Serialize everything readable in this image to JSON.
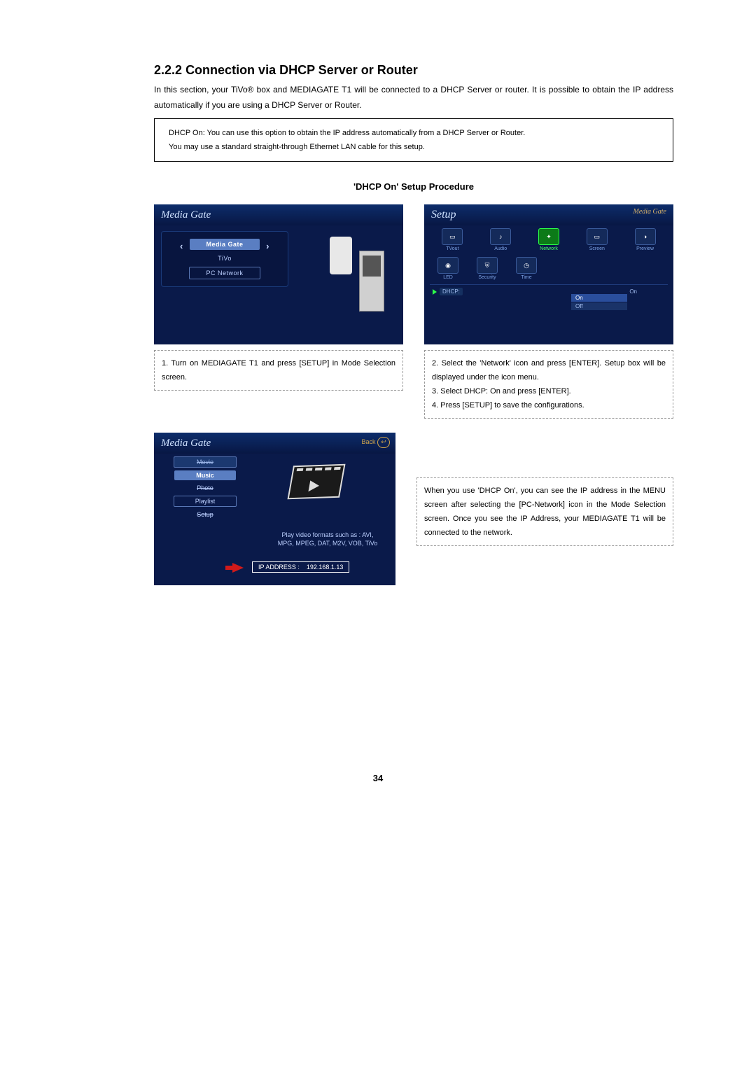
{
  "section": {
    "number": "2.2.2",
    "title": "Connection via DHCP Server or Router",
    "intro": "In this section, your TiVo® box and MEDIAGATE T1 will be connected to a DHCP Server or router. It is possible to obtain the IP address automatically if you are using a DHCP Server or Router."
  },
  "note_box": {
    "line1": "DHCP On: You can use this option to obtain the IP address automatically from a DHCP Server or Router.",
    "line2": "You may use a standard straight-through Ethernet LAN cable for this setup."
  },
  "procedure_title": "'DHCP On' Setup Procedure",
  "figure1": {
    "brand": "Media Gate",
    "menu": {
      "item1": "Media Gate",
      "item2": "TiVo",
      "item3": "PC Network"
    }
  },
  "figure2": {
    "title": "Setup",
    "brand_small": "Media Gate",
    "row1": {
      "i1": "TVout",
      "i2": "Audio",
      "i3": "Network",
      "i4": "Screen",
      "i5": "Preview"
    },
    "row2": {
      "i1": "LED",
      "i2": "Security",
      "i3": "Time"
    },
    "dhcp_label": "DHCP:",
    "dhcp_value": "On",
    "opt_on": "On",
    "opt_off": "Off"
  },
  "figure3": {
    "brand": "Media Gate",
    "back": "Back",
    "menu": {
      "i0": "Movie",
      "i1": "Music",
      "i2": "Photo",
      "i3": "Playlist",
      "i4": "Setup"
    },
    "formats_line1": "Play video formats such as : AVI,",
    "formats_line2": "MPG, MPEG, DAT, M2V, VOB, TiVo",
    "ip_label": "IP ADDRESS :",
    "ip_value": "192.168.1.13"
  },
  "caption1": "1. Turn on MEDIAGATE T1 and press [SETUP] in Mode Selection screen.",
  "caption2": {
    "l1": "2. Select the 'Network' icon and press [ENTER]. Setup box will be displayed under the icon menu.",
    "l2": "3. Select DHCP: On and press [ENTER].",
    "l3": "4. Press [SETUP] to save the configurations."
  },
  "caption3": "When you use 'DHCP On', you can see the IP address in the MENU screen after selecting the [PC-Network] icon in the Mode Selection screen. Once you see the IP Address, your MEDIAGATE T1 will be connected to the network.",
  "page_number": "34"
}
